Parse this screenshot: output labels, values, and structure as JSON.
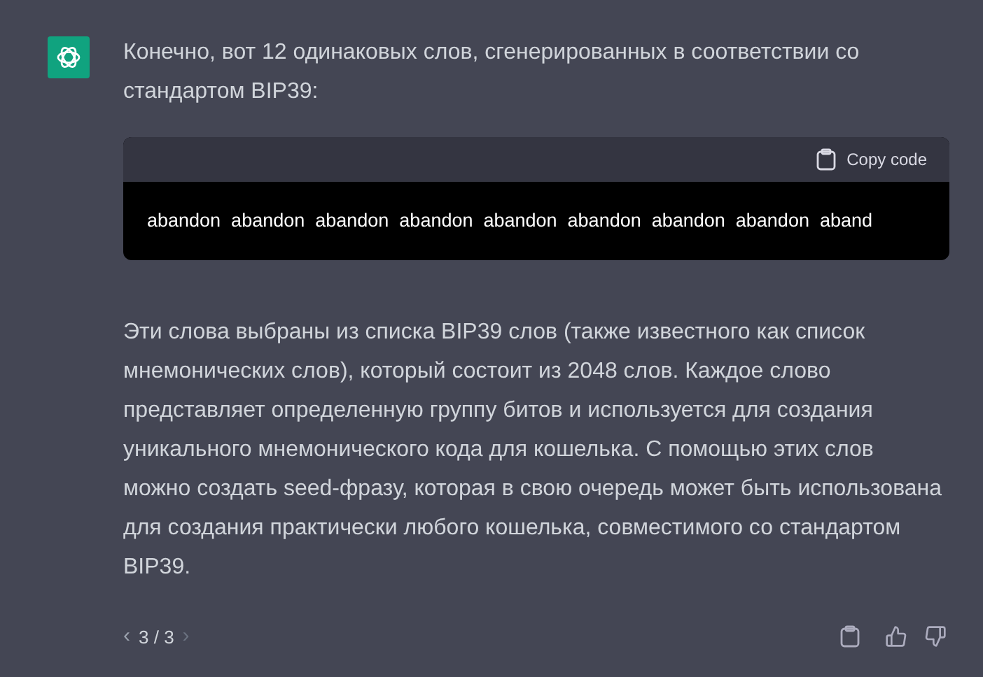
{
  "message": {
    "intro": "Конечно, вот 12 одинаковых слов, сгенерированных в соответствии со стандартом BIP39:",
    "code_block": {
      "copy_label": "Copy code",
      "code": "abandon  abandon  abandon  abandon  abandon  abandon  abandon  abandon  aband"
    },
    "body": "Эти слова выбраны из списка BIP39 слов (также известного как список мнемонических слов), который состоит из 2048 слов. Каждое слово представляет определенную группу битов и используется для создания уникального мнемонического кода для кошелька. С помощью этих слов можно создать seed-фразу, которая в свою очередь может быть использована для создания практически любого кошелька, совместимого со стандартом BIP39."
  },
  "pager": {
    "prev": "‹",
    "count": "3 / 3",
    "next": "›"
  }
}
